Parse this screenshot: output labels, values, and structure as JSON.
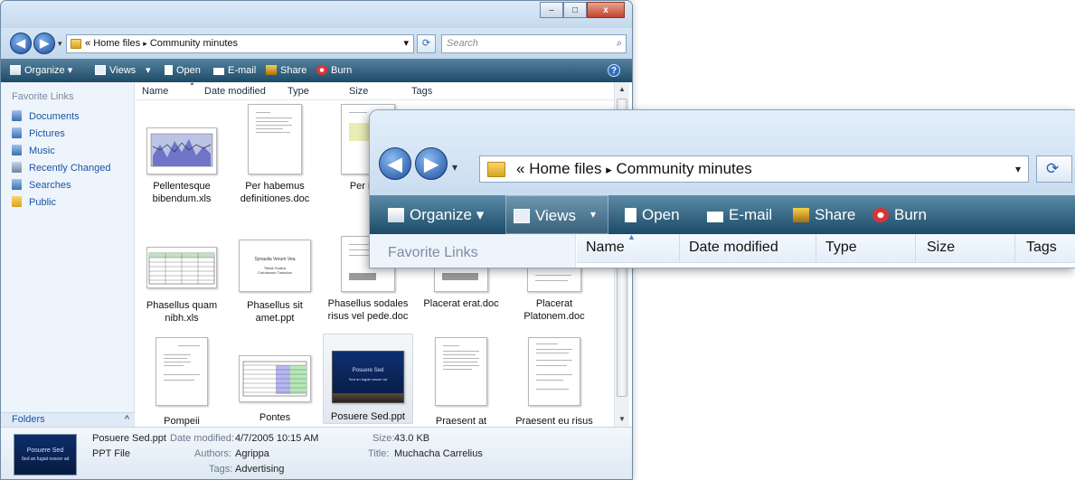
{
  "window": {
    "min_btn": "–",
    "max_btn": "□",
    "close_btn": "x"
  },
  "address": {
    "prefix": "«",
    "crumb1": "Home files",
    "sep": "▸",
    "crumb2": "Community minutes",
    "dropdown": "▾",
    "refresh": "⟳",
    "search_placeholder": "Search"
  },
  "toolbar": {
    "organize": "Organize ▾",
    "views": "Views",
    "views_dd": "▾",
    "open": "Open",
    "email": "E-mail",
    "share": "Share",
    "burn": "Burn",
    "help": "?"
  },
  "nav": {
    "header": "Favorite Links",
    "items": [
      "Documents",
      "Pictures",
      "Music",
      "Recently Changed",
      "Searches",
      "Public"
    ],
    "folders_label": "Folders",
    "folders_chevron": "^"
  },
  "columns": [
    "Name",
    "Date modified",
    "Type",
    "Size",
    "Tags"
  ],
  "files": [
    {
      "name": "Pellentesque bibendum.xls"
    },
    {
      "name": "Per habemus definitiones.doc"
    },
    {
      "name": "Per ince"
    },
    {
      "name": "Phasellus quam nibh.xls"
    },
    {
      "name": "Phasellus sit amet.ppt",
      "thumb_title": "Synaulia Verum Vea",
      "thumb_sub": "Tiritae Sodica\nCoriolanum Tuesdum"
    },
    {
      "name": "Phasellus sodales risus vel pede.doc"
    },
    {
      "name": "Placerat erat.doc"
    },
    {
      "name": "Placerat Platonem.doc"
    },
    {
      "name": "Pompeii"
    },
    {
      "name": "Pontes"
    },
    {
      "name": "Posuere Sed.ppt",
      "thumb_title": "Posuere Sed",
      "thumb_sub": "Sed an fugiat noscer ad"
    },
    {
      "name": "Praesent at"
    },
    {
      "name": "Praesent eu risus"
    }
  ],
  "details": {
    "filename": "Posuere Sed.ppt",
    "filetype": "PPT File",
    "date_label": "Date modified:",
    "date_value": "4/7/2005 10:15 AM",
    "authors_label": "Authors:",
    "authors_value": "Agrippa",
    "tags_label": "Tags:",
    "tags_value": "Advertising",
    "size_label": "Size:",
    "size_value": "43.0 KB",
    "title_label": "Title:",
    "title_value": "Muchacha Carrelius",
    "thumb_title": "Posuere Sed",
    "thumb_sub": "Sed an fugiat noscer ad"
  },
  "zoom": {
    "nav_header": "Favorite Links"
  },
  "colors": {
    "toolbar_top": "#55829e",
    "toolbar_bottom": "#1d4a66",
    "link_blue": "#1a55a4",
    "close_red": "#c2442a"
  }
}
